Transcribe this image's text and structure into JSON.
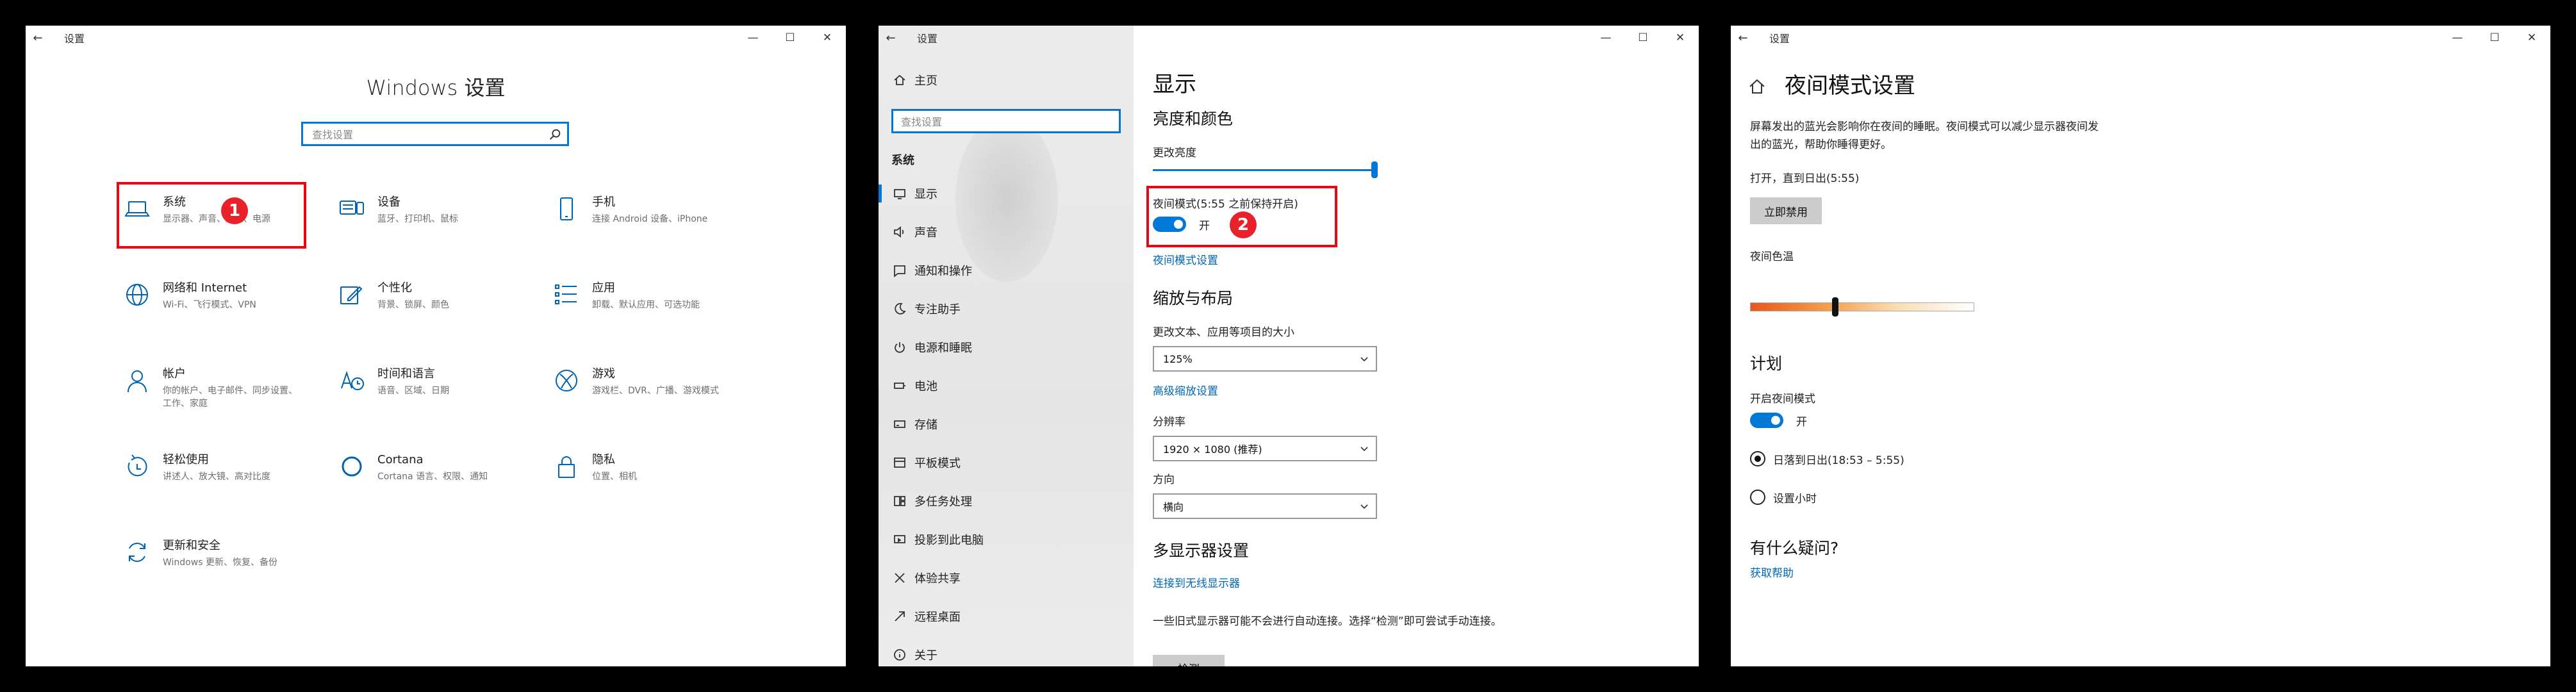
{
  "window1": {
    "title": "设置",
    "controls": [
      "—",
      "☐",
      "✕"
    ],
    "heading": "Windows 设置",
    "search_placeholder": "查找设置",
    "tiles": [
      {
        "title": "系统",
        "desc": "显示器、声音、通知、电源",
        "icon": "laptop-icon"
      },
      {
        "title": "设备",
        "desc": "蓝牙、打印机、鼠标",
        "icon": "devices-icon"
      },
      {
        "title": "手机",
        "desc": "连接 Android 设备、iPhone",
        "icon": "phone-icon"
      },
      {
        "title": "网络和 Internet",
        "desc": "Wi-Fi、飞行模式、VPN",
        "icon": "globe-icon"
      },
      {
        "title": "个性化",
        "desc": "背景、锁屏、颜色",
        "icon": "paint-icon"
      },
      {
        "title": "应用",
        "desc": "卸载、默认应用、可选功能",
        "icon": "apps-list-icon"
      },
      {
        "title": "帐户",
        "desc": "你的帐户、电子邮件、同步设置、工作、家庭",
        "icon": "person-icon"
      },
      {
        "title": "时间和语言",
        "desc": "语音、区域、日期",
        "icon": "time-language-icon"
      },
      {
        "title": "游戏",
        "desc": "游戏栏、DVR、广播、游戏模式",
        "icon": "xbox-icon"
      },
      {
        "title": "轻松使用",
        "desc": "讲述人、放大镜、高对比度",
        "icon": "ease-of-access-icon"
      },
      {
        "title": "Cortana",
        "desc": "Cortana 语言、权限、通知",
        "icon": "cortana-icon"
      },
      {
        "title": "隐私",
        "desc": "位置、相机",
        "icon": "lock-icon"
      },
      {
        "title": "更新和安全",
        "desc": "Windows 更新、恢复、备份",
        "icon": "update-icon"
      }
    ],
    "badge": "1",
    "highlight_color": "#e50914"
  },
  "window2": {
    "title": "设置",
    "controls": [
      "—",
      "☐",
      "✕"
    ],
    "home": "主页",
    "search_placeholder": "查找设置",
    "section": "系统",
    "nav": [
      {
        "label": "显示",
        "icon": "monitor-icon",
        "active": true
      },
      {
        "label": "声音",
        "icon": "speaker-icon"
      },
      {
        "label": "通知和操作",
        "icon": "notification-icon"
      },
      {
        "label": "专注助手",
        "icon": "moon-icon"
      },
      {
        "label": "电源和睡眠",
        "icon": "power-icon"
      },
      {
        "label": "电池",
        "icon": "battery-icon"
      },
      {
        "label": "存储",
        "icon": "storage-icon"
      },
      {
        "label": "平板模式",
        "icon": "tablet-icon"
      },
      {
        "label": "多任务处理",
        "icon": "multitask-icon"
      },
      {
        "label": "投影到此电脑",
        "icon": "project-icon"
      },
      {
        "label": "体验共享",
        "icon": "share-icon"
      },
      {
        "label": "远程桌面",
        "icon": "remote-icon"
      },
      {
        "label": "关于",
        "icon": "info-icon"
      }
    ],
    "main": {
      "heading": "显示",
      "section_brightness": "亮度和颜色",
      "brightness_label": "更改亮度",
      "brightness_value": 1.0,
      "night_label": "夜间模式(5:55 之前保持开启)",
      "night_state": "开",
      "night_link": "夜间模式设置",
      "section_scale": "缩放与布局",
      "scale_label": "更改文本、应用等项目的大小",
      "scale_value": "125%",
      "advanced_link": "高级缩放设置",
      "resolution_label": "分辨率",
      "resolution_value": "1920 × 1080 (推荐)",
      "orientation_label": "方向",
      "orientation_value": "横向",
      "section_multi": "多显示器设置",
      "wireless_link": "连接到无线显示器",
      "multi_desc": "一些旧式显示器可能不会进行自动连接。选择“检测”即可尝试手动连接。",
      "detect_button": "检测"
    },
    "badge": "2"
  },
  "window3": {
    "title": "设置",
    "controls": [
      "—",
      "☐",
      "✕"
    ],
    "heading": "夜间模式设置",
    "desc": "屏幕发出的蓝光会影响你在夜间的睡眠。夜间模式可以减少显示器夜间发出的蓝光，帮助你睡得更好。",
    "status": "打开，直到日出(5:55)",
    "disable_button": "立即禁用",
    "temp_label": "夜间色温",
    "temp_value": 0.38,
    "schedule_heading": "计划",
    "schedule_label": "开启夜间模式",
    "schedule_state": "开",
    "option_sunset": "日落到日出(18:53 – 5:55)",
    "option_hours": "设置小时",
    "question_heading": "有什么疑问?",
    "help_link": "获取帮助"
  }
}
